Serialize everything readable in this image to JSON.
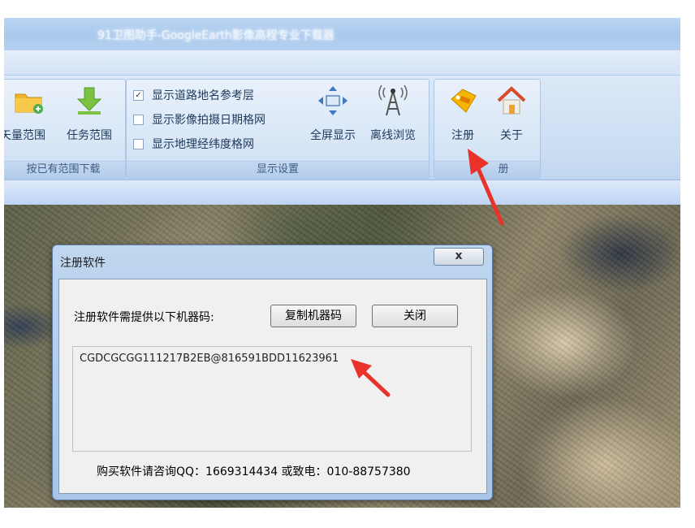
{
  "app": {
    "title": "91卫图助手-GoogleEarth影像高程专业下载器"
  },
  "ribbon": {
    "download_group": {
      "buttons": [
        {
          "label": "矢量范围",
          "icon": "folder-icon"
        },
        {
          "label": "任务范围",
          "icon": "download-arrow-icon"
        }
      ],
      "footer": "按已有范围下载"
    },
    "display_group": {
      "checkboxes": [
        {
          "label": "显示道路地名参考层",
          "checked": true
        },
        {
          "label": "显示影像拍摄日期格网",
          "checked": false
        },
        {
          "label": "显示地理经纬度格网",
          "checked": false
        }
      ],
      "buttons": [
        {
          "label": "全屏显示",
          "icon": "fullscreen-icon"
        },
        {
          "label": "离线浏览",
          "icon": "antenna-icon"
        }
      ],
      "footer": "显示设置"
    },
    "help_group": {
      "buttons": [
        {
          "label": "注册",
          "icon": "tag-icon"
        },
        {
          "label": "关于",
          "icon": "home-icon"
        }
      ],
      "footer": "册"
    }
  },
  "dialog": {
    "title": "注册软件",
    "close_glyph": "x",
    "prompt": "注册软件需提供以下机器码:",
    "copy_button": "复制机器码",
    "close_button": "关闭",
    "machine_code": "CGDCGCGG111217B2EB@816591BDD11623961",
    "contact": "购买软件请咨询QQ：1669314434 或致电：010-88757380"
  },
  "colors": {
    "annotation_arrow": "#e8322a",
    "ribbon_text": "#1e395b"
  }
}
